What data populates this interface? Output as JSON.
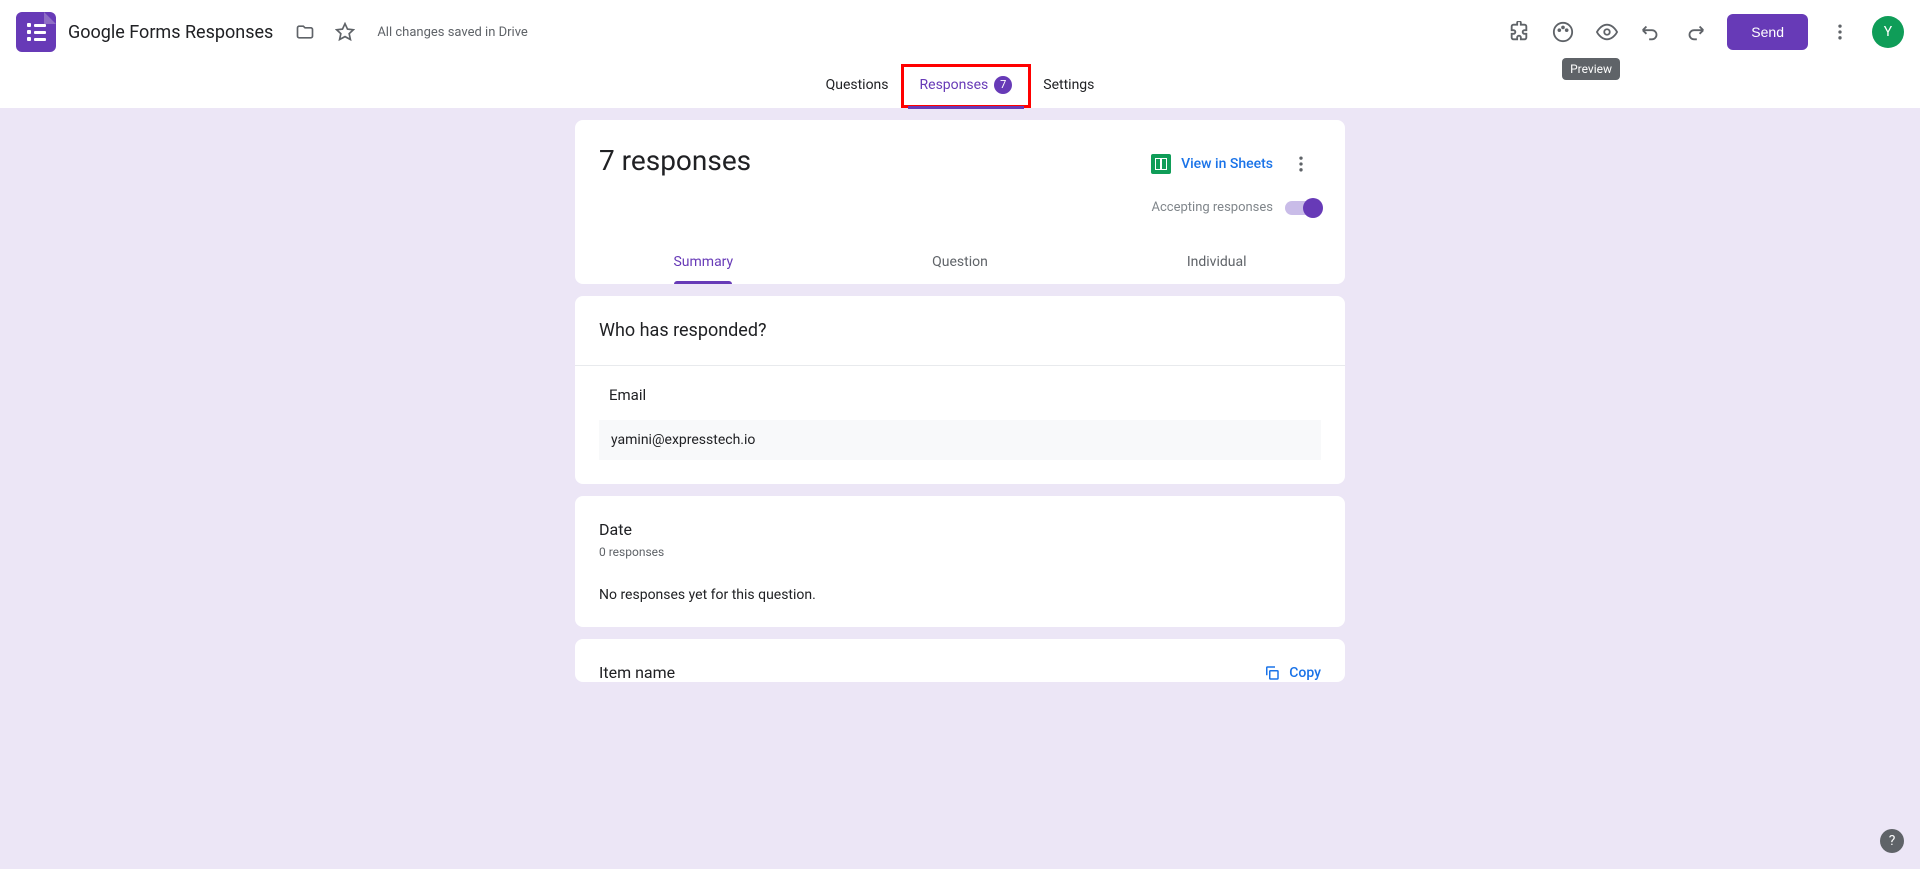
{
  "header": {
    "title": "Google Forms Responses",
    "save_status": "All changes saved in Drive",
    "send_label": "Send",
    "avatar_initial": "Y",
    "tooltip": "Preview"
  },
  "nav_tabs": {
    "questions": "Questions",
    "responses": "Responses",
    "responses_count": "7",
    "settings": "Settings"
  },
  "responses_card": {
    "title": "7 responses",
    "view_sheets": "View in Sheets",
    "accepting_label": "Accepting responses"
  },
  "sub_tabs": {
    "summary": "Summary",
    "question": "Question",
    "individual": "Individual"
  },
  "who_responded": {
    "title": "Who has responded?",
    "email_label": "Email",
    "email_value": "yamini@expresstech.io"
  },
  "date_section": {
    "title": "Date",
    "count": "0 responses",
    "empty": "No responses yet for this question."
  },
  "item_section": {
    "title": "Item name",
    "copy": "Copy"
  }
}
